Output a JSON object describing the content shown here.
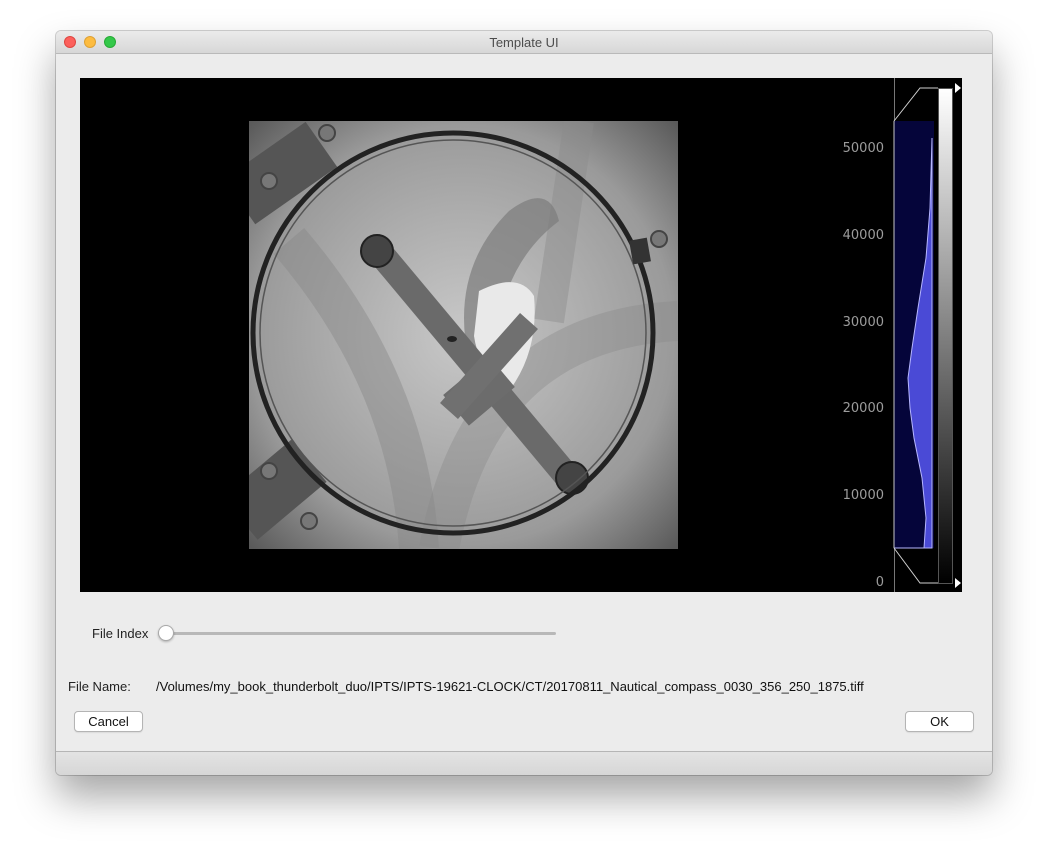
{
  "window": {
    "title": "Template UI"
  },
  "viewer": {
    "histogram": {
      "ticks": [
        "50000",
        "40000",
        "30000",
        "20000",
        "10000",
        "0"
      ],
      "fill_color": "#4a4ad6",
      "background_color": "#05053a"
    }
  },
  "controls": {
    "file_index_label": "File Index",
    "file_index_value": 0,
    "file_name_label": "File Name:",
    "file_name_value": "/Volumes/my_book_thunderbolt_duo/IPTS/IPTS-19621-CLOCK/CT/20170811_Nautical_compass_0030_356_250_1875.tiff"
  },
  "buttons": {
    "cancel_label": "Cancel",
    "ok_label": "OK"
  }
}
